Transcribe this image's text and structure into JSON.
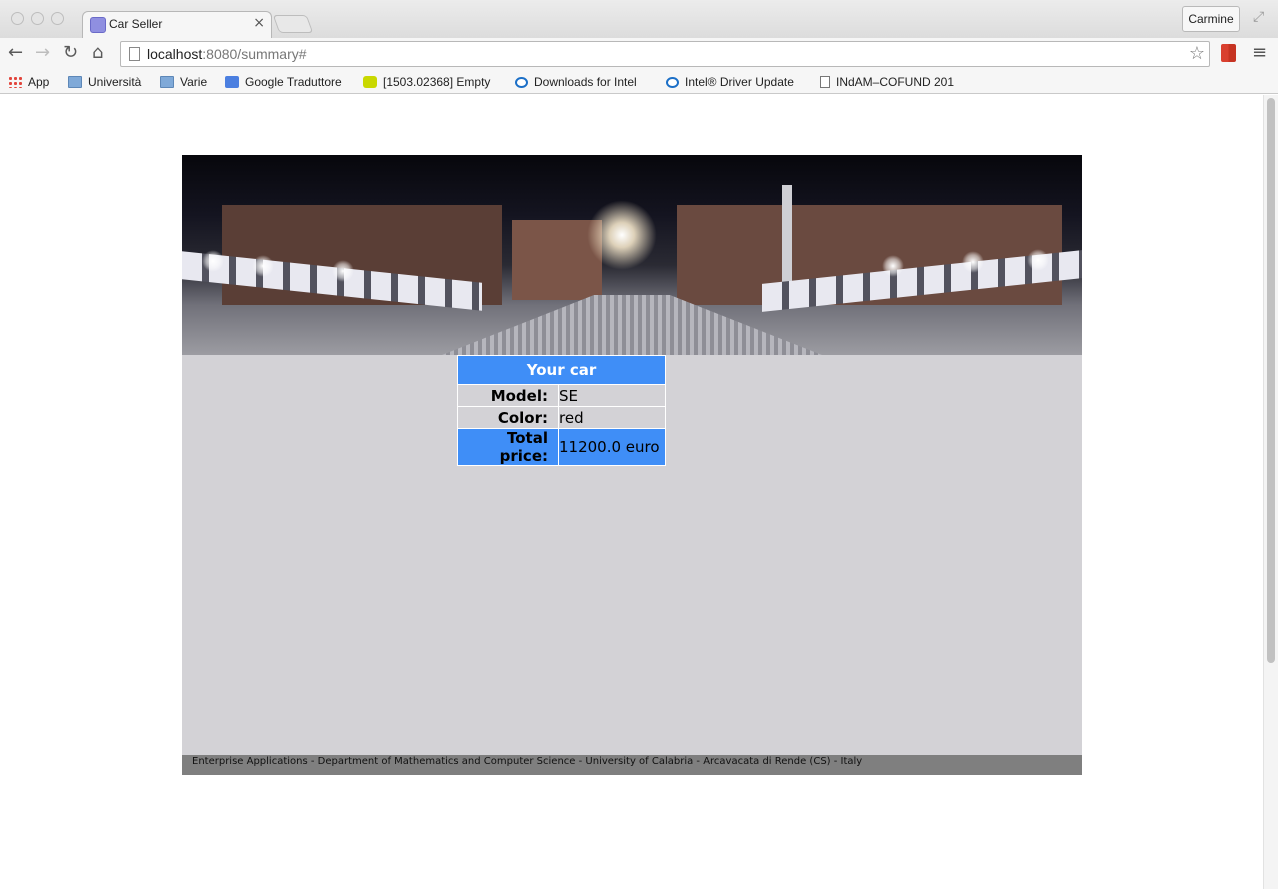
{
  "browser": {
    "tab_title": "Car Seller",
    "tab_close": "×",
    "profile_name": "Carmine",
    "url_host": "localhost",
    "url_rest": ":8080/summary#",
    "bookmarks": [
      {
        "label": "App",
        "icon": "apps-grid-icon"
      },
      {
        "label": "Università",
        "icon": "folder-icon"
      },
      {
        "label": "Varie",
        "icon": "folder-icon"
      },
      {
        "label": "Google Traduttore",
        "icon": "google-translate-icon"
      },
      {
        "label": "[1503.02368] Empty",
        "icon": "smiley-icon"
      },
      {
        "label": "Downloads for Intel",
        "icon": "intel-icon"
      },
      {
        "label": "Intel® Driver Update",
        "icon": "intel-icon"
      },
      {
        "label": "INdAM–COFUND 201",
        "icon": "document-icon"
      }
    ]
  },
  "summary": {
    "header": "Your car",
    "rows": [
      {
        "label": "Model:",
        "value": "SE"
      },
      {
        "label": "Color:",
        "value": "red"
      },
      {
        "label": "Total price:",
        "value": "11200.0 euro"
      }
    ]
  },
  "footer": {
    "text": "Enterprise Applications - Department of Mathematics and Computer Science - University of Calabria - Arcavacata di Rende (CS) - Italy"
  },
  "colors": {
    "header_bg": "#3f8ef7",
    "content_bg": "#d3d2d6",
    "footer_bg": "#7f7f7f"
  }
}
